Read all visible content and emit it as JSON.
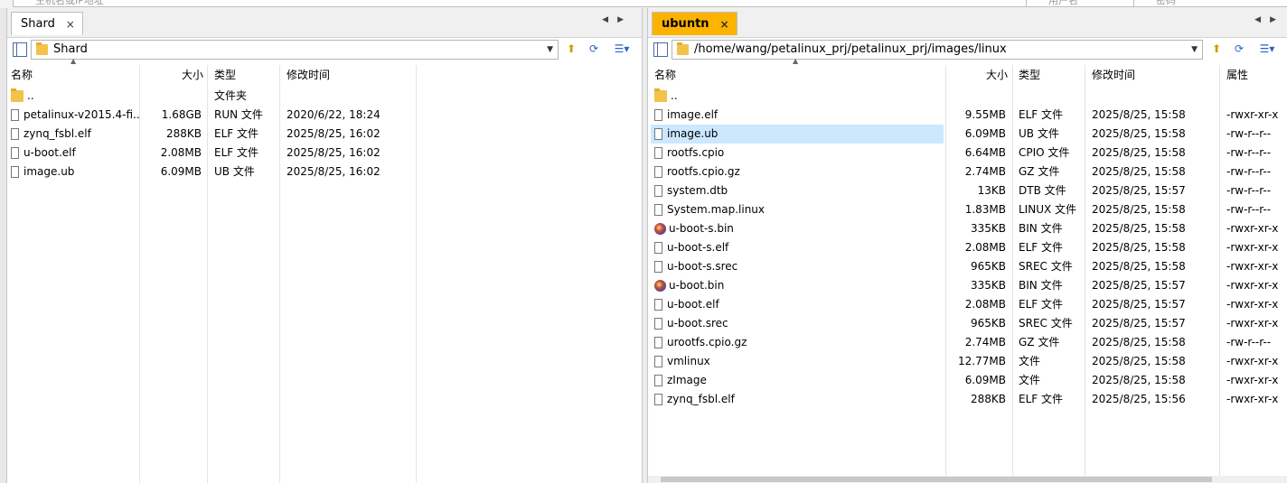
{
  "top_fields": {
    "host_placeholder": "主机名或IP地址",
    "user_placeholder": "用户名",
    "pass_placeholder": "密码"
  },
  "left_pane": {
    "tab_label": "Shard",
    "tab_close": "×",
    "path": "Shard",
    "columns": {
      "name": "名称",
      "size": "大小",
      "type": "类型",
      "modified": "修改时间"
    },
    "rows": [
      {
        "name": "..",
        "size": "",
        "type": "文件夹",
        "modified": "",
        "icon": "folder-icon"
      },
      {
        "name": "petalinux-v2015.4-fi...",
        "size": "1.68GB",
        "type": "RUN 文件",
        "modified": "2020/6/22, 18:24",
        "icon": "file-icon"
      },
      {
        "name": "zynq_fsbl.elf",
        "size": "288KB",
        "type": "ELF 文件",
        "modified": "2025/8/25, 16:02",
        "icon": "file-icon"
      },
      {
        "name": "u-boot.elf",
        "size": "2.08MB",
        "type": "ELF 文件",
        "modified": "2025/8/25, 16:02",
        "icon": "file-icon"
      },
      {
        "name": "image.ub",
        "size": "6.09MB",
        "type": "UB 文件",
        "modified": "2025/8/25, 16:02",
        "icon": "file-icon"
      }
    ]
  },
  "right_pane": {
    "tab_label": "ubuntn",
    "tab_close": "×",
    "path": "/home/wang/petalinux_prj/petalinux_prj/images/linux",
    "columns": {
      "name": "名称",
      "size": "大小",
      "type": "类型",
      "modified": "修改时间",
      "attrs": "属性"
    },
    "selected_row": "image.ub",
    "rows": [
      {
        "name": "..",
        "size": "",
        "type": "",
        "modified": "",
        "attrs": "",
        "icon": "folder-icon"
      },
      {
        "name": "image.elf",
        "size": "9.55MB",
        "type": "ELF 文件",
        "modified": "2025/8/25, 15:58",
        "attrs": "-rwxr-xr-x",
        "icon": "file-icon"
      },
      {
        "name": "image.ub",
        "size": "6.09MB",
        "type": "UB 文件",
        "modified": "2025/8/25, 15:58",
        "attrs": "-rw-r--r--",
        "icon": "file-icon"
      },
      {
        "name": "rootfs.cpio",
        "size": "6.64MB",
        "type": "CPIO 文件",
        "modified": "2025/8/25, 15:58",
        "attrs": "-rw-r--r--",
        "icon": "file-icon"
      },
      {
        "name": "rootfs.cpio.gz",
        "size": "2.74MB",
        "type": "GZ 文件",
        "modified": "2025/8/25, 15:58",
        "attrs": "-rw-r--r--",
        "icon": "file-icon"
      },
      {
        "name": "system.dtb",
        "size": "13KB",
        "type": "DTB 文件",
        "modified": "2025/8/25, 15:57",
        "attrs": "-rw-r--r--",
        "icon": "file-icon"
      },
      {
        "name": "System.map.linux",
        "size": "1.83MB",
        "type": "LINUX 文件",
        "modified": "2025/8/25, 15:58",
        "attrs": "-rw-r--r--",
        "icon": "file-icon"
      },
      {
        "name": "u-boot-s.bin",
        "size": "335KB",
        "type": "BIN 文件",
        "modified": "2025/8/25, 15:58",
        "attrs": "-rwxr-xr-x",
        "icon": "bin-icon"
      },
      {
        "name": "u-boot-s.elf",
        "size": "2.08MB",
        "type": "ELF 文件",
        "modified": "2025/8/25, 15:58",
        "attrs": "-rwxr-xr-x",
        "icon": "file-icon"
      },
      {
        "name": "u-boot-s.srec",
        "size": "965KB",
        "type": "SREC 文件",
        "modified": "2025/8/25, 15:58",
        "attrs": "-rwxr-xr-x",
        "icon": "file-icon"
      },
      {
        "name": "u-boot.bin",
        "size": "335KB",
        "type": "BIN 文件",
        "modified": "2025/8/25, 15:57",
        "attrs": "-rwxr-xr-x",
        "icon": "bin-icon"
      },
      {
        "name": "u-boot.elf",
        "size": "2.08MB",
        "type": "ELF 文件",
        "modified": "2025/8/25, 15:57",
        "attrs": "-rwxr-xr-x",
        "icon": "file-icon"
      },
      {
        "name": "u-boot.srec",
        "size": "965KB",
        "type": "SREC 文件",
        "modified": "2025/8/25, 15:57",
        "attrs": "-rwxr-xr-x",
        "icon": "file-icon"
      },
      {
        "name": "urootfs.cpio.gz",
        "size": "2.74MB",
        "type": "GZ 文件",
        "modified": "2025/8/25, 15:58",
        "attrs": "-rw-r--r--",
        "icon": "file-icon"
      },
      {
        "name": "vmlinux",
        "size": "12.77MB",
        "type": "文件",
        "modified": "2025/8/25, 15:58",
        "attrs": "-rwxr-xr-x",
        "icon": "file-icon"
      },
      {
        "name": "zImage",
        "size": "6.09MB",
        "type": "文件",
        "modified": "2025/8/25, 15:58",
        "attrs": "-rwxr-xr-x",
        "icon": "file-icon"
      },
      {
        "name": "zynq_fsbl.elf",
        "size": "288KB",
        "type": "ELF 文件",
        "modified": "2025/8/25, 15:56",
        "attrs": "-rwxr-xr-x",
        "icon": "file-icon"
      }
    ]
  },
  "colors": {
    "active_tab": "#fbb300",
    "selection": "#cce8ff",
    "folder": "#f2c24b"
  }
}
